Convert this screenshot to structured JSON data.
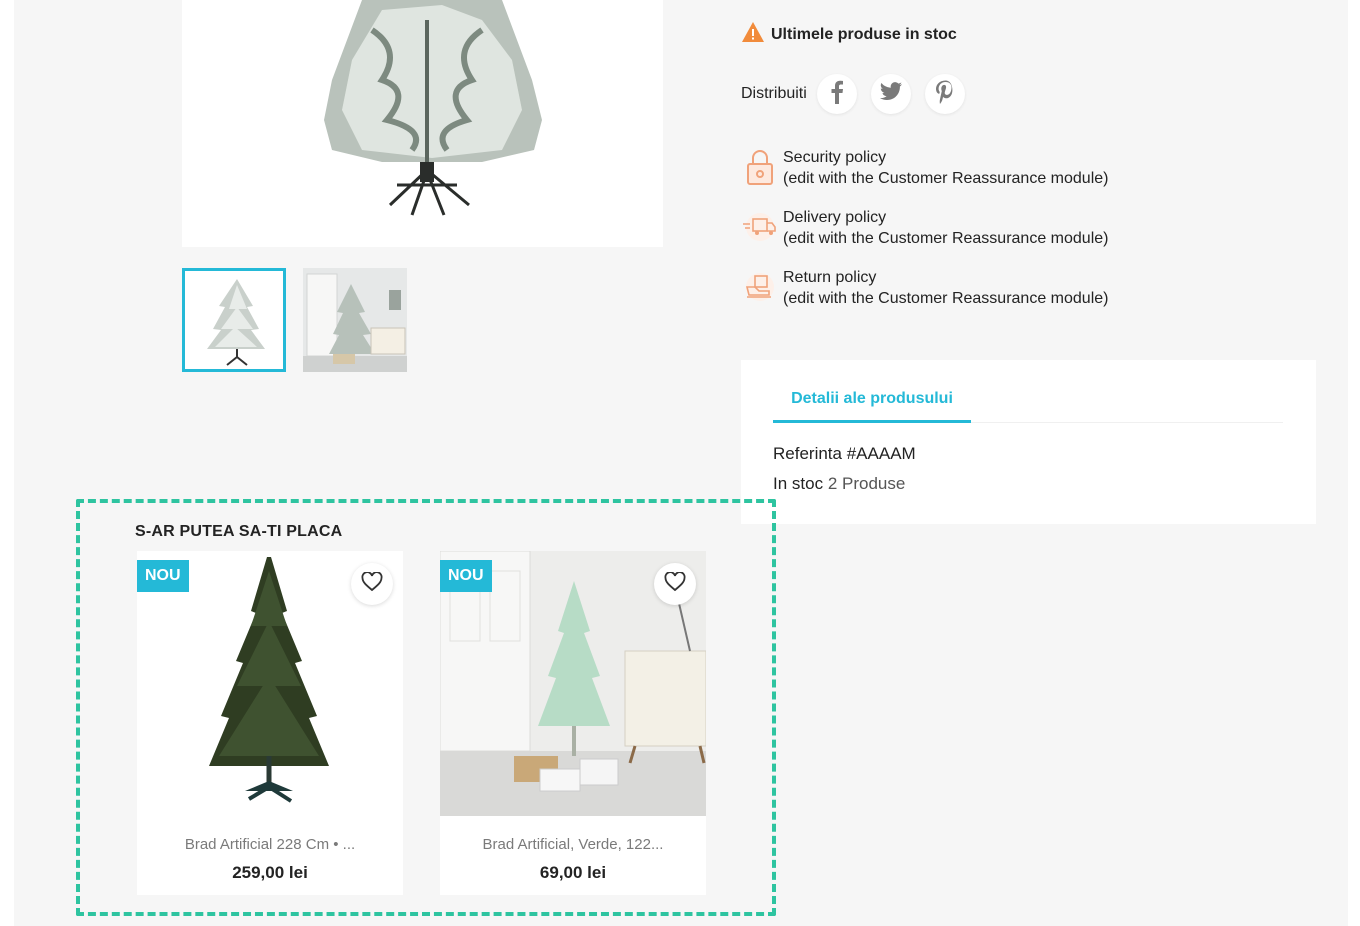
{
  "stock_notice": {
    "text": "Ultimele produse in stoc",
    "icon": "warning-icon",
    "color": "#f18b3b"
  },
  "share": {
    "label": "Distribuiti",
    "buttons": [
      {
        "name": "facebook",
        "icon": "facebook-icon"
      },
      {
        "name": "twitter",
        "icon": "twitter-icon"
      },
      {
        "name": "pinterest",
        "icon": "pinterest-icon"
      }
    ]
  },
  "reassurance": [
    {
      "title": "Security policy",
      "subtitle": "(edit with the Customer Reassurance module)",
      "icon": "lock-icon"
    },
    {
      "title": "Delivery policy",
      "subtitle": "(edit with the Customer Reassurance module)",
      "icon": "truck-icon"
    },
    {
      "title": "Return policy",
      "subtitle": "(edit with the Customer Reassurance module)",
      "icon": "return-box-icon"
    }
  ],
  "details": {
    "tab_label": "Detalii ale produsului",
    "reference_label": "Referinta",
    "reference_value": "#AAAAM",
    "stock_label": "In stoc",
    "stock_value": "2 Produse"
  },
  "related": {
    "title": "S-AR PUTEA SA-TI PLACA",
    "products": [
      {
        "badge": "NOU",
        "name": "Brad Artificial 228 Cm • ...",
        "price": "259,00 lei"
      },
      {
        "badge": "NOU",
        "name": "Brad Artificial, Verde, 122...",
        "price": "69,00 lei"
      }
    ]
  },
  "colors": {
    "accent": "#24b9d7",
    "highlight_frame": "#2ec4a0",
    "reassurance_icon": "#f0a27a"
  }
}
